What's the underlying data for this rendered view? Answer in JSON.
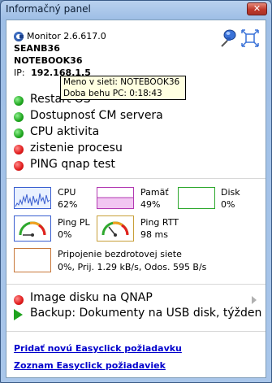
{
  "window": {
    "title": "Informačný panel",
    "close_symbol": "✕"
  },
  "header": {
    "app_version": "Monitor 2.6.617.0",
    "user": "SEANB36",
    "computer": "NOTEBOOK36",
    "ip_label": "IP:",
    "ip_value": "192.168.1.5"
  },
  "tooltip": {
    "line1": "Meno v sieti: NOTEBOOK36",
    "line2": "Doba behu PC: 0:18:43"
  },
  "status_items": [
    {
      "label": "Restart OS",
      "status": "green"
    },
    {
      "label": "Dostupnosť CM servera",
      "status": "green"
    },
    {
      "label": "CPU aktivita",
      "status": "green"
    },
    {
      "label": "zistenie procesu",
      "status": "red"
    },
    {
      "label": "PING  qnap test",
      "status": "red"
    }
  ],
  "metrics": {
    "cpu": {
      "label": "CPU",
      "value": "62%",
      "color": "#3a5fd0"
    },
    "memory": {
      "label": "Pamäť",
      "value": "49%",
      "color": "#b23ab2"
    },
    "disk": {
      "label": "Disk",
      "value": "0%",
      "color": "#2ea82e"
    },
    "ping_pl": {
      "label": "Ping PL",
      "value": "0%"
    },
    "ping_rtt": {
      "label": "Ping RTT",
      "value": "98 ms"
    },
    "wireless": {
      "label": "Pripojenie bezdrotovej siete",
      "value": "0%, Prij. 1.29 kB/s, Odos. 595 B/s",
      "color": "#c8783a"
    }
  },
  "tasks": [
    {
      "label": "Image disku na QNAP",
      "status": "red"
    },
    {
      "label": "Backup: Dokumenty na USB disk, týžden",
      "status": "play"
    }
  ],
  "links": {
    "add_request": "Pridať novú Easyclick požiadavku",
    "list_requests": "Zoznam Easyclick požiadaviek"
  }
}
